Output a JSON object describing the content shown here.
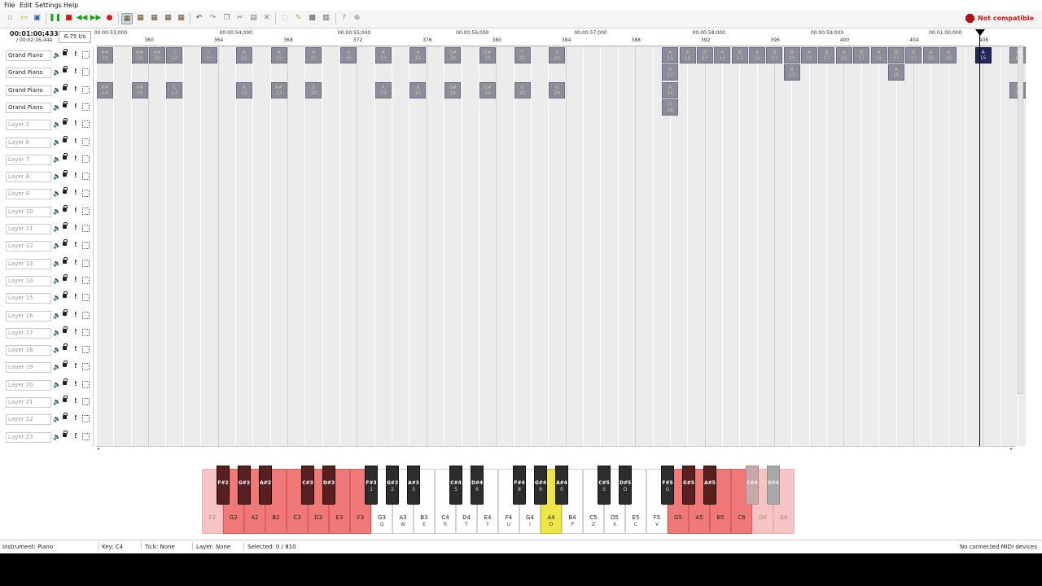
{
  "menu": [
    "File",
    "Edit",
    "Settings",
    "Help"
  ],
  "compatibility": {
    "label": "Not compatible",
    "icon": "hexagon-stop-icon"
  },
  "time": {
    "current": "00:01:00;433",
    "total": "/ 00:02:16;444"
  },
  "tempo": "6.75 t/s",
  "layers": [
    {
      "name": "Grand Piano",
      "dim": false
    },
    {
      "name": "Grand Piano",
      "dim": false
    },
    {
      "name": "Grand Piano",
      "dim": false
    },
    {
      "name": "Grand Piano",
      "dim": false
    },
    {
      "name": "Layer 5",
      "dim": true
    },
    {
      "name": "Layer 6",
      "dim": true
    },
    {
      "name": "Layer 7",
      "dim": true
    },
    {
      "name": "Layer 8",
      "dim": true
    },
    {
      "name": "Layer 9",
      "dim": true
    },
    {
      "name": "Layer 10",
      "dim": true
    },
    {
      "name": "Layer 11",
      "dim": true
    },
    {
      "name": "Layer 12",
      "dim": true
    },
    {
      "name": "Layer 13",
      "dim": true
    },
    {
      "name": "Layer 14",
      "dim": true
    },
    {
      "name": "Layer 15",
      "dim": true
    },
    {
      "name": "Layer 16",
      "dim": true
    },
    {
      "name": "Layer 17",
      "dim": true
    },
    {
      "name": "Layer 18",
      "dim": true
    },
    {
      "name": "Layer 19",
      "dim": true
    },
    {
      "name": "Layer 20",
      "dim": true
    },
    {
      "name": "Layer 21",
      "dim": true
    },
    {
      "name": "Layer 22",
      "dim": true
    },
    {
      "name": "Layer 23",
      "dim": true
    }
  ],
  "timeline": {
    "time_labels": [
      {
        "tick": 357,
        "text": "00:00:53;000"
      },
      {
        "tick": 364.2,
        "text": "00:00:54;000"
      },
      {
        "tick": 371,
        "text": "00:00:55;000"
      },
      {
        "tick": 377.8,
        "text": "00:00:56;000"
      },
      {
        "tick": 384.6,
        "text": "00:00:57;000"
      },
      {
        "tick": 391.4,
        "text": "00:00:58;000"
      },
      {
        "tick": 398.2,
        "text": "00:00:59;000"
      },
      {
        "tick": 405,
        "text": "00:01:00;000"
      }
    ],
    "ticks": [
      360,
      364,
      368,
      372,
      376,
      380,
      384,
      388,
      392,
      396,
      400,
      404,
      408
    ],
    "start_tick": 357,
    "playhead_tick": 408
  },
  "notes": [
    {
      "tick": 357,
      "layer": 0,
      "key": "A#",
      "inst": "16"
    },
    {
      "tick": 359,
      "layer": 0,
      "key": "A#",
      "inst": "16"
    },
    {
      "tick": 360,
      "layer": 0,
      "key": "A#",
      "inst": "16"
    },
    {
      "tick": 361,
      "layer": 0,
      "key": "C",
      "inst": "12"
    },
    {
      "tick": 363,
      "layer": 0,
      "key": "C",
      "inst": "17"
    },
    {
      "tick": 365,
      "layer": 0,
      "key": "A",
      "inst": "15"
    },
    {
      "tick": 367,
      "layer": 0,
      "key": "A",
      "inst": "15"
    },
    {
      "tick": 369,
      "layer": 0,
      "key": "A",
      "inst": "15"
    },
    {
      "tick": 371,
      "layer": 0,
      "key": "A",
      "inst": "15"
    },
    {
      "tick": 373,
      "layer": 0,
      "key": "A",
      "inst": "15"
    },
    {
      "tick": 375,
      "layer": 0,
      "key": "A",
      "inst": "15"
    },
    {
      "tick": 377,
      "layer": 0,
      "key": "G#",
      "inst": "19"
    },
    {
      "tick": 379,
      "layer": 0,
      "key": "G#",
      "inst": "19"
    },
    {
      "tick": 381,
      "layer": 0,
      "key": "F",
      "inst": "22"
    },
    {
      "tick": 383,
      "layer": 0,
      "key": "G",
      "inst": "20"
    },
    {
      "tick": 389.5,
      "layer": 0,
      "key": "A",
      "inst": "15"
    },
    {
      "tick": 390.5,
      "layer": 0,
      "key": "A",
      "inst": "15"
    },
    {
      "tick": 391.5,
      "layer": 0,
      "key": "B",
      "inst": "17"
    },
    {
      "tick": 392.5,
      "layer": 0,
      "key": "A",
      "inst": "15"
    },
    {
      "tick": 393.5,
      "layer": 0,
      "key": "B",
      "inst": "17"
    },
    {
      "tick": 394.5,
      "layer": 0,
      "key": "A",
      "inst": "15"
    },
    {
      "tick": 395.5,
      "layer": 0,
      "key": "B",
      "inst": "17"
    },
    {
      "tick": 396.5,
      "layer": 0,
      "key": "A",
      "inst": "15"
    },
    {
      "tick": 397.5,
      "layer": 0,
      "key": "A",
      "inst": "15"
    },
    {
      "tick": 398.5,
      "layer": 0,
      "key": "B",
      "inst": "17"
    },
    {
      "tick": 399.5,
      "layer": 0,
      "key": "A",
      "inst": "15"
    },
    {
      "tick": 400.5,
      "layer": 0,
      "key": "B",
      "inst": "17"
    },
    {
      "tick": 401.5,
      "layer": 0,
      "key": "A",
      "inst": "15"
    },
    {
      "tick": 402.5,
      "layer": 0,
      "key": "B",
      "inst": "17"
    },
    {
      "tick": 403.5,
      "layer": 0,
      "key": "B",
      "inst": "17"
    },
    {
      "tick": 404.5,
      "layer": 0,
      "key": "A",
      "inst": "15"
    },
    {
      "tick": 405.5,
      "layer": 0,
      "key": "A",
      "inst": "15"
    },
    {
      "tick": 407.5,
      "layer": 0,
      "key": "A",
      "inst": "15",
      "selected": true
    },
    {
      "tick": 409.5,
      "layer": 0,
      "key": "A",
      "inst": "14"
    },
    {
      "tick": 389.5,
      "layer": 1,
      "key": "B",
      "inst": "17"
    },
    {
      "tick": 396.5,
      "layer": 1,
      "key": "B",
      "inst": "17"
    },
    {
      "tick": 402.5,
      "layer": 1,
      "key": "A",
      "inst": "15"
    },
    {
      "tick": 357,
      "layer": 2,
      "key": "A#",
      "inst": "16"
    },
    {
      "tick": 359,
      "layer": 2,
      "key": "A#",
      "inst": "16"
    },
    {
      "tick": 361,
      "layer": 2,
      "key": "C",
      "inst": "13"
    },
    {
      "tick": 365,
      "layer": 2,
      "key": "A",
      "inst": "15"
    },
    {
      "tick": 367,
      "layer": 2,
      "key": "A#",
      "inst": "23"
    },
    {
      "tick": 369,
      "layer": 2,
      "key": "B",
      "inst": "20"
    },
    {
      "tick": 373,
      "layer": 2,
      "key": "A",
      "inst": "15"
    },
    {
      "tick": 375,
      "layer": 2,
      "key": "A",
      "inst": "15"
    },
    {
      "tick": 377,
      "layer": 2,
      "key": "G#",
      "inst": "19"
    },
    {
      "tick": 379,
      "layer": 2,
      "key": "G#",
      "inst": "19"
    },
    {
      "tick": 381,
      "layer": 2,
      "key": "G",
      "inst": "20"
    },
    {
      "tick": 383,
      "layer": 2,
      "key": "G",
      "inst": "20"
    },
    {
      "tick": 389.5,
      "layer": 2,
      "key": "A",
      "inst": "15"
    },
    {
      "tick": 409.5,
      "layer": 2,
      "key": "F",
      "inst": "22"
    },
    {
      "tick": 389.5,
      "layer": 3,
      "key": "G",
      "inst": "18"
    }
  ],
  "keyboard": {
    "white_keys": [
      {
        "note": "F2",
        "key": "",
        "state": "pink"
      },
      {
        "note": "G2",
        "key": "",
        "state": "red"
      },
      {
        "note": "A2",
        "key": "",
        "state": "red"
      },
      {
        "note": "B2",
        "key": "",
        "state": "red"
      },
      {
        "note": "C3",
        "key": "",
        "state": "red"
      },
      {
        "note": "D3",
        "key": "",
        "state": "red"
      },
      {
        "note": "E3",
        "key": "",
        "state": "red"
      },
      {
        "note": "F3",
        "key": "",
        "state": "red"
      },
      {
        "note": "G3",
        "key": "Q",
        "state": "normal"
      },
      {
        "note": "A3",
        "key": "W",
        "state": "normal"
      },
      {
        "note": "B3",
        "key": "E",
        "state": "normal"
      },
      {
        "note": "C4",
        "key": "R",
        "state": "normal"
      },
      {
        "note": "D4",
        "key": "T",
        "state": "normal"
      },
      {
        "note": "E4",
        "key": "Y",
        "state": "normal"
      },
      {
        "note": "F4",
        "key": "U",
        "state": "normal"
      },
      {
        "note": "G4",
        "key": "I",
        "state": "normal"
      },
      {
        "note": "A4",
        "key": "O",
        "state": "yellow"
      },
      {
        "note": "B4",
        "key": "P",
        "state": "normal"
      },
      {
        "note": "C5",
        "key": "Z",
        "state": "normal"
      },
      {
        "note": "D5",
        "key": "X",
        "state": "normal"
      },
      {
        "note": "E5",
        "key": "C",
        "state": "normal"
      },
      {
        "note": "F5",
        "key": "V",
        "state": "normal"
      },
      {
        "note": "G5",
        "key": "",
        "state": "red"
      },
      {
        "note": "A5",
        "key": "",
        "state": "red"
      },
      {
        "note": "B5",
        "key": "",
        "state": "red"
      },
      {
        "note": "C6",
        "key": "",
        "state": "red"
      },
      {
        "note": "D6",
        "key": "",
        "state": "pink"
      },
      {
        "note": "E6",
        "key": "",
        "state": "pink"
      }
    ],
    "black_keys": [
      {
        "after": 0,
        "note": "F#2",
        "key": "",
        "state": "red"
      },
      {
        "after": 1,
        "note": "G#2",
        "key": "",
        "state": "red"
      },
      {
        "after": 2,
        "note": "A#2",
        "key": "",
        "state": "red"
      },
      {
        "after": 4,
        "note": "C#3",
        "key": "",
        "state": "red"
      },
      {
        "after": 5,
        "note": "D#3",
        "key": "",
        "state": "red"
      },
      {
        "after": 7,
        "note": "F#3",
        "key": "1",
        "state": "normal"
      },
      {
        "after": 8,
        "note": "G#3",
        "key": "2",
        "state": "normal"
      },
      {
        "after": 9,
        "note": "A#3",
        "key": "3",
        "state": "normal"
      },
      {
        "after": 11,
        "note": "C#4",
        "key": "5",
        "state": "normal"
      },
      {
        "after": 12,
        "note": "D#4",
        "key": "6",
        "state": "normal"
      },
      {
        "after": 14,
        "note": "F#4",
        "key": "8",
        "state": "normal"
      },
      {
        "after": 15,
        "note": "G#4",
        "key": "9",
        "state": "normal"
      },
      {
        "after": 16,
        "note": "A#4",
        "key": "0",
        "state": "normal"
      },
      {
        "after": 18,
        "note": "C#5",
        "key": "S",
        "state": "normal"
      },
      {
        "after": 19,
        "note": "D#5",
        "key": "D",
        "state": "normal"
      },
      {
        "after": 21,
        "note": "F#5",
        "key": "G",
        "state": "normal"
      },
      {
        "after": 22,
        "note": "G#5",
        "key": "",
        "state": "red"
      },
      {
        "after": 23,
        "note": "A#5",
        "key": "",
        "state": "red"
      },
      {
        "after": 25,
        "note": "C#6",
        "key": "",
        "state": "pale"
      },
      {
        "after": 26,
        "note": "D#6",
        "key": "",
        "state": "pale2"
      }
    ]
  },
  "status": {
    "instrument": "Instrument: Piano",
    "key": "Key: C4",
    "tick": "Tick: None",
    "layer": "Layer: None",
    "selected": "Selected: 0 / 810",
    "midi": "No connected MIDI devices"
  },
  "colors": {
    "note": "#8b8d9c",
    "note_selected": "#22295a",
    "grid": "#ececec",
    "pressed_red": "#f07878",
    "current_yellow": "#ece64a"
  }
}
